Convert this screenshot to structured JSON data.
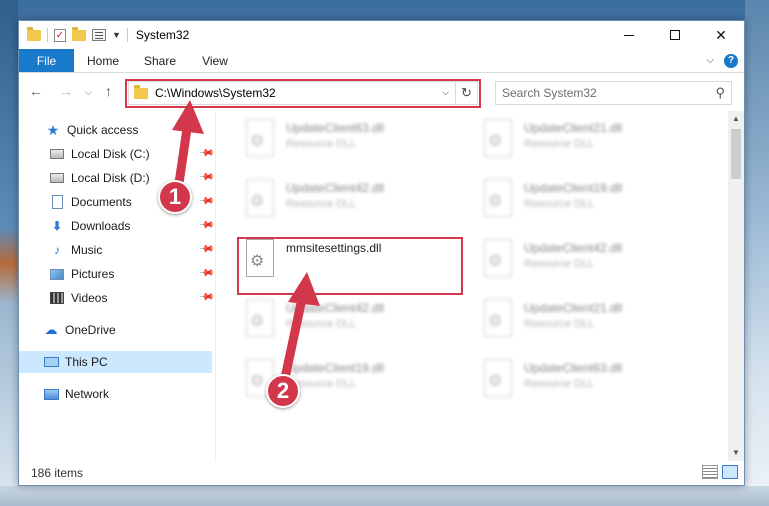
{
  "window": {
    "title": "System32",
    "minimize_icon": "minimize-icon",
    "maximize_icon": "maximize-icon",
    "close_label": "✕"
  },
  "ribbon": {
    "tabs": [
      {
        "label": "File"
      },
      {
        "label": "Home"
      },
      {
        "label": "Share"
      },
      {
        "label": "View"
      }
    ],
    "help_label": "?"
  },
  "nav": {
    "address_path": "C:\\Windows\\System32",
    "search_placeholder": "Search System32"
  },
  "sidebar": {
    "items": [
      {
        "label": "Quick access",
        "icon": "star-icon"
      },
      {
        "label": "Local Disk (C:)",
        "icon": "disk-icon",
        "pinned": true
      },
      {
        "label": "Local Disk (D:)",
        "icon": "disk-icon",
        "pinned": true
      },
      {
        "label": "Documents",
        "icon": "documents-icon",
        "pinned": true
      },
      {
        "label": "Downloads",
        "icon": "downloads-icon",
        "pinned": true
      },
      {
        "label": "Music",
        "icon": "music-icon",
        "pinned": true
      },
      {
        "label": "Pictures",
        "icon": "pictures-icon",
        "pinned": true
      },
      {
        "label": "Videos",
        "icon": "videos-icon",
        "pinned": true
      },
      {
        "label": "OneDrive",
        "icon": "cloud-icon"
      },
      {
        "label": "This PC",
        "icon": "computer-icon",
        "selected": true
      },
      {
        "label": "Network",
        "icon": "network-icon"
      }
    ]
  },
  "files": {
    "col1": [
      {
        "name": "UpdateClient63.dll",
        "type": "Resource DLL"
      },
      {
        "name": "UpdateClient42.dll",
        "type": "Resource DLL"
      },
      {
        "name": "mmsitesettings.dll",
        "type": ""
      },
      {
        "name": "UpdateClient42.dll",
        "type": "Resource DLL"
      },
      {
        "name": "UpdateClient19.dll",
        "type": "Resource DLL"
      }
    ],
    "col2": [
      {
        "name": "UpdateClient21.dll",
        "type": "Resource DLL"
      },
      {
        "name": "UpdateClient19.dll",
        "type": "Resource DLL"
      },
      {
        "name": "UpdateClient42.dll",
        "type": "Resource DLL"
      },
      {
        "name": "UpdateClient21.dll",
        "type": "Resource DLL"
      },
      {
        "name": "UpdateClient63.dll",
        "type": "Resource DLL"
      }
    ]
  },
  "status": {
    "item_count": "186 items"
  },
  "callouts": {
    "one": "1",
    "two": "2"
  },
  "colors": {
    "accent": "#1979ca",
    "highlight": "#d3374b",
    "selection": "#cce8ff"
  }
}
